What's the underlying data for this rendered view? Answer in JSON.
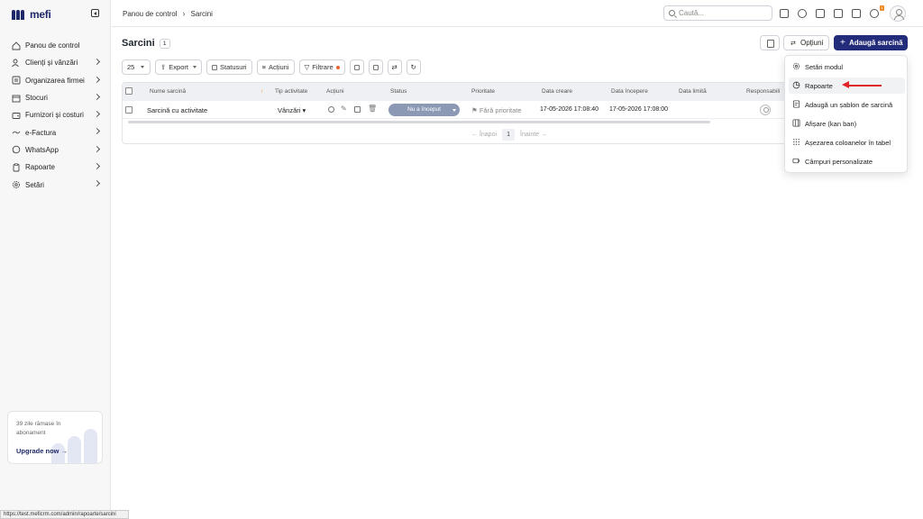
{
  "brand": {
    "name": "mefi"
  },
  "sidebar": {
    "items": [
      {
        "label": "Panou de control",
        "icon": "home-icon",
        "chevron": false
      },
      {
        "label": "Clienți și vânzări",
        "icon": "users-icon",
        "chevron": true
      },
      {
        "label": "Organizarea firmei",
        "icon": "org-icon",
        "chevron": true
      },
      {
        "label": "Stocuri",
        "icon": "box-icon",
        "chevron": true
      },
      {
        "label": "Furnizori și costuri",
        "icon": "wallet-icon",
        "chevron": true
      },
      {
        "label": "e-Factura",
        "icon": "link-icon",
        "chevron": true
      },
      {
        "label": "WhatsApp",
        "icon": "chat-icon",
        "chevron": true
      },
      {
        "label": "Rapoarte",
        "icon": "clipboard-icon",
        "chevron": true
      },
      {
        "label": "Setări",
        "icon": "gear-icon",
        "chevron": true
      }
    ],
    "upgrade": {
      "message": "39 zile rămase în abonament",
      "cta": "Upgrade now"
    }
  },
  "status_url": "https://test.meficrm.com/admin/rapoarte/sarcini",
  "header": {
    "breadcrumb": [
      "Panou de control",
      "Sarcini"
    ],
    "search_placeholder": "Caută...",
    "notification_count": "1"
  },
  "page": {
    "title": "Sarcini",
    "count": "1",
    "options_label": "Opțiuni",
    "add_label": "Adaugă sarcină"
  },
  "toolbar": {
    "per_page": "25",
    "export_label": "Export",
    "status_label": "Statusuri",
    "actions_label": "Acțiuni",
    "filter_label": "Filtrare"
  },
  "table": {
    "columns": [
      "Nume sarcină",
      "Tip activitate",
      "Acțiuni",
      "Status",
      "Prioritate",
      "Data creare",
      "Data începere",
      "Data limită",
      "Responsabili"
    ],
    "rows": [
      {
        "name": "Sarcină cu activitate",
        "type": "Vânzări",
        "status": "Nu a început",
        "priority": "Fără prioritate",
        "created": "17-05-2026 17:08:40",
        "start": "17-05-2026 17:08:00",
        "deadline": ""
      }
    ],
    "pager": {
      "prev": "← Înapoi",
      "page": "1",
      "next": "Înainte →"
    }
  },
  "dropdown": {
    "items": [
      {
        "label": "Setări modul",
        "icon": "gear-icon"
      },
      {
        "label": "Rapoarte",
        "icon": "chart-icon"
      },
      {
        "label": "Adaugă un șablon de sarcină",
        "icon": "template-icon"
      },
      {
        "label": "Afișare (kan ban)",
        "icon": "kanban-icon"
      },
      {
        "label": "Așezarea coloanelor în tabel",
        "icon": "grid-icon"
      },
      {
        "label": "Câmpuri personalizate",
        "icon": "fields-icon"
      }
    ]
  },
  "colors": {
    "primary": "#232c7a",
    "status_pill": "#8c99b5",
    "annotation_arrow": "#e0242a",
    "filter_dot": "#f0642b",
    "badge": "#f08a24"
  }
}
